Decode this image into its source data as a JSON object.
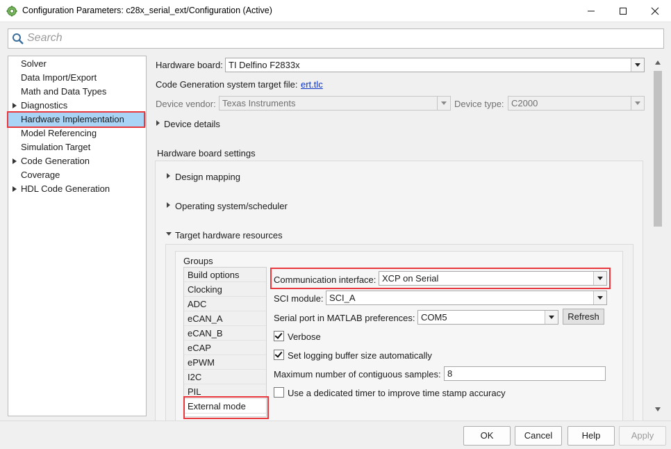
{
  "window": {
    "title": "Configuration Parameters: c28x_serial_ext/Configuration (Active)",
    "controls": [
      "minimize-icon",
      "maximize-icon",
      "close-icon"
    ]
  },
  "search": {
    "placeholder": "Search"
  },
  "tree": {
    "items": [
      {
        "label": "Solver",
        "expandable": false
      },
      {
        "label": "Data Import/Export",
        "expandable": false
      },
      {
        "label": "Math and Data Types",
        "expandable": false
      },
      {
        "label": "Diagnostics",
        "expandable": true
      },
      {
        "label": "Hardware Implementation",
        "expandable": false,
        "selected": true
      },
      {
        "label": "Model Referencing",
        "expandable": false
      },
      {
        "label": "Simulation Target",
        "expandable": false
      },
      {
        "label": "Code Generation",
        "expandable": true
      },
      {
        "label": "Coverage",
        "expandable": false
      },
      {
        "label": "HDL Code Generation",
        "expandable": true
      }
    ]
  },
  "hardware": {
    "board_label": "Hardware board:",
    "board_value": "TI Delfino F2833x",
    "target_file_label": "Code Generation system target file:",
    "target_file_link": "ert.tlc",
    "vendor_label": "Device vendor:",
    "vendor_value": "Texas Instruments",
    "type_label": "Device type:",
    "type_value": "C2000",
    "device_details": "Device details",
    "board_settings_title": "Hardware board settings",
    "design_mapping": "Design mapping",
    "os_scheduler": "Operating system/scheduler",
    "target_resources": "Target hardware resources"
  },
  "groups": {
    "title": "Groups",
    "items": [
      "Build options",
      "Clocking",
      "ADC",
      "eCAN_A",
      "eCAN_B",
      "eCAP",
      "ePWM",
      "I2C",
      "PIL",
      "External mode"
    ],
    "active": "External mode"
  },
  "external_mode": {
    "comm_label": "Communication interface:",
    "comm_value": "XCP on Serial",
    "sci_label": "SCI module:",
    "sci_value": "SCI_A",
    "serial_label": "Serial port in MATLAB preferences:",
    "serial_value": "COM5",
    "refresh_label": "Refresh",
    "verbose_label": "Verbose",
    "verbose_checked": true,
    "logging_label": "Set logging buffer size automatically",
    "logging_checked": true,
    "max_samples_label": "Maximum number of contiguous samples:",
    "max_samples_value": "8",
    "timer_label": "Use a dedicated timer to improve time stamp accuracy",
    "timer_checked": false
  },
  "footer": {
    "ok": "OK",
    "cancel": "Cancel",
    "help": "Help",
    "apply": "Apply"
  },
  "colors": {
    "selection": "#a9d4f5",
    "highlight_border": "#e8383d",
    "link": "#0a34c8"
  }
}
